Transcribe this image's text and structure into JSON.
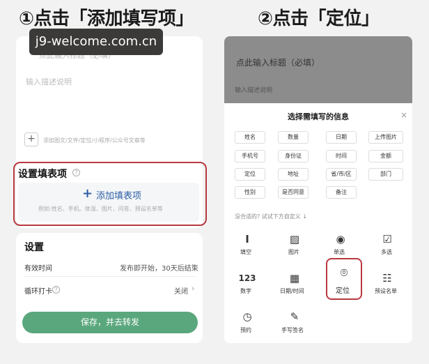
{
  "steps": {
    "step1": "①点击「添加填写项」",
    "step2": "②点击「定位」"
  },
  "watermark": "j9-welcome.com.cn",
  "left": {
    "title_placeholder": "点此输入标题（必填）",
    "desc_placeholder": "输入描述说明",
    "attach_icon": "plus",
    "attach_hint": "添加图文/文件/定位/小程序/公众号文章等",
    "form_section": {
      "title": "设置填表项",
      "add_label": "添加填表项",
      "add_hint": "例如:姓名、手机、体温、图片、问答、预设名单等"
    },
    "settings": {
      "title": "设置",
      "rows": [
        {
          "label": "有效时间",
          "value": "发布即开始，30天后结束"
        },
        {
          "label": "循环打卡",
          "value": "关闭"
        }
      ]
    },
    "save_button": "保存，并去转发"
  },
  "right": {
    "title_placeholder": "点此输入标题（必填）",
    "desc_placeholder": "输入描述说明",
    "sheet_title": "选择需填写的信息",
    "close": "×",
    "chips": [
      [
        "姓名",
        "数量",
        "日期",
        "上传图片"
      ],
      [
        "手机号",
        "身份证",
        "时间",
        "金额"
      ],
      [
        "定位",
        "地址",
        "省/市/区",
        "部门"
      ],
      [
        "性别",
        "是否同意",
        "备注"
      ]
    ],
    "custom_hint": "没合适的? 试试下方自定义 ↓",
    "types": [
      {
        "icon": "text-icon",
        "glyph": "Ⅰ",
        "label": "填空"
      },
      {
        "icon": "image-icon",
        "glyph": "▨",
        "label": "图片"
      },
      {
        "icon": "radio-icon",
        "glyph": "◉",
        "label": "单选"
      },
      {
        "icon": "checkbox-icon",
        "glyph": "☑",
        "label": "多选"
      },
      {
        "icon": "number-icon",
        "glyph": "123",
        "label": "数字"
      },
      {
        "icon": "calendar-icon",
        "glyph": "▦",
        "label": "日期/时间"
      },
      {
        "icon": "location-pin-icon",
        "glyph": "⌾",
        "label": "定位"
      },
      {
        "icon": "list-icon",
        "glyph": "☷",
        "label": "预设名单"
      },
      {
        "icon": "booking-icon",
        "glyph": "◷",
        "label": "预约"
      },
      {
        "icon": "signature-icon",
        "glyph": "✎",
        "label": "手写签名"
      }
    ]
  },
  "colors": {
    "accent_blue": "#2d5fa6",
    "highlight_red": "#b8393f",
    "save_green": "#5aa77d"
  }
}
